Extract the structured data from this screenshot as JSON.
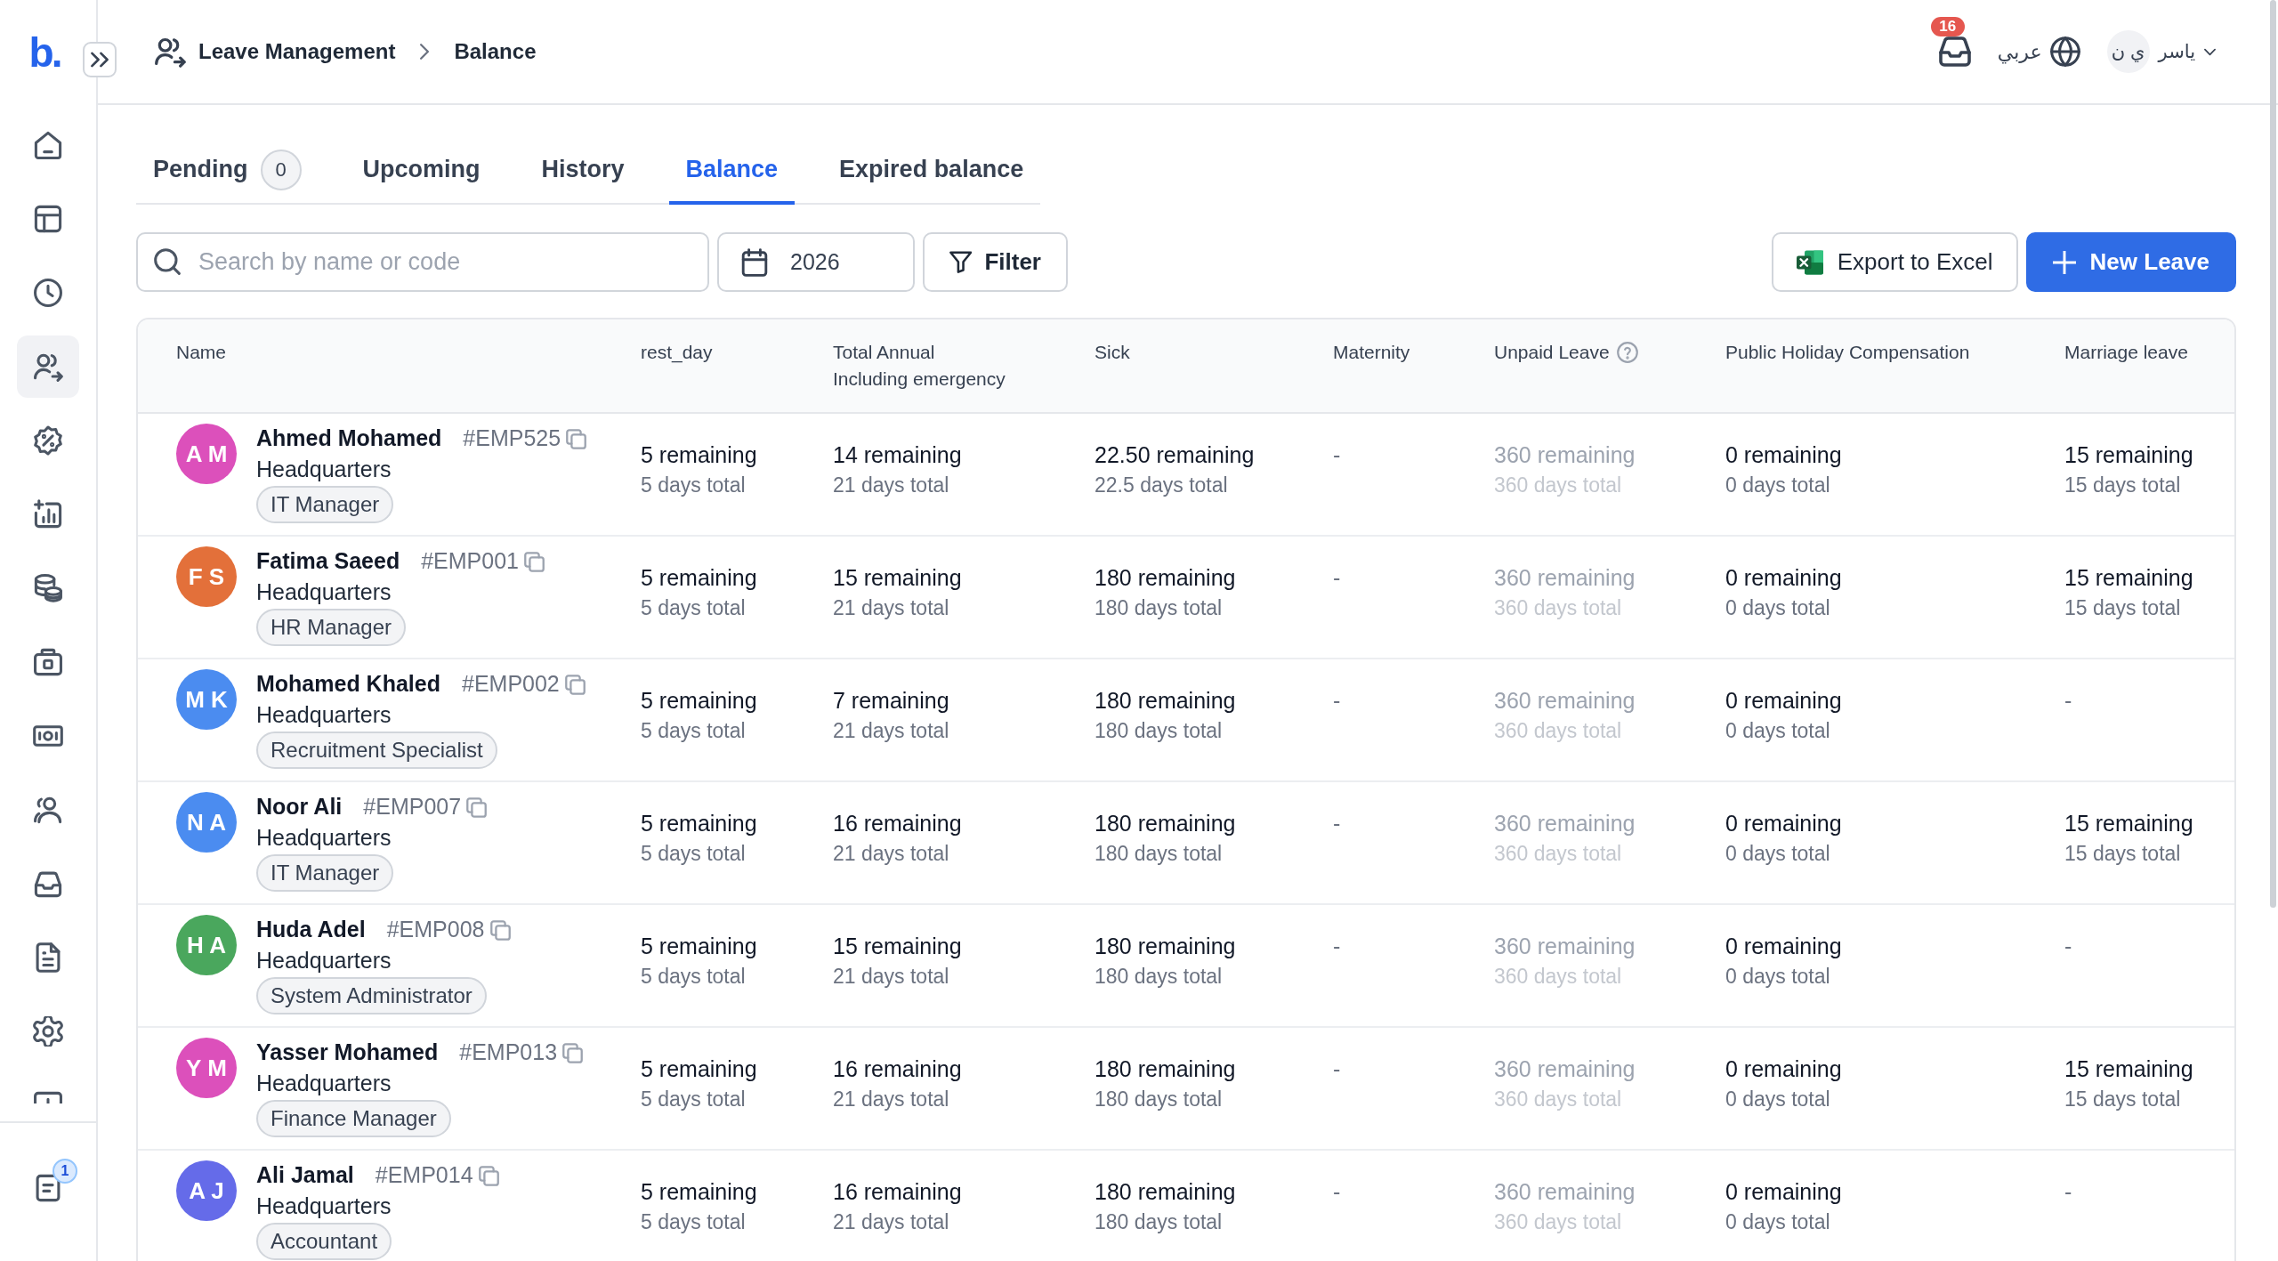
{
  "sidebar": {
    "logo": "b.",
    "items": [
      {
        "selected": false
      },
      {
        "selected": false
      },
      {
        "selected": false
      },
      {
        "selected": true
      },
      {
        "selected": false
      },
      {
        "selected": false
      },
      {
        "selected": false
      },
      {
        "selected": false
      },
      {
        "selected": false
      },
      {
        "selected": false
      },
      {
        "selected": false
      },
      {
        "selected": false
      },
      {
        "selected": false
      },
      {
        "selected": false
      }
    ],
    "footer_badge": "1"
  },
  "header": {
    "breadcrumb": [
      "Leave Management",
      "Balance"
    ],
    "notifications_count": "16",
    "language": "عربي",
    "user": {
      "initials": "ي ن",
      "name": "ياسر"
    }
  },
  "tabs": [
    {
      "label": "Pending",
      "count": "0",
      "selected": false
    },
    {
      "label": "Upcoming",
      "selected": false
    },
    {
      "label": "History",
      "selected": false
    },
    {
      "label": "Balance",
      "selected": true
    },
    {
      "label": "Expired balance",
      "selected": false
    }
  ],
  "toolbar": {
    "search": {
      "placeholder": "Search by name or code"
    },
    "year": "2026",
    "filter": "Filter",
    "export": "Export to Excel",
    "new_leave": "New Leave"
  },
  "table": {
    "columns": [
      {
        "label": "Name"
      },
      {
        "label": "rest_day"
      },
      {
        "label": "Total Annual",
        "sublabel": "Including emergency"
      },
      {
        "label": "Sick"
      },
      {
        "label": "Maternity"
      },
      {
        "label": "Unpaid Leave",
        "info_icon": true,
        "muted": true
      },
      {
        "label": "Public Holiday Compensation"
      },
      {
        "label": "Marriage leave"
      }
    ],
    "rows": [
      {
        "initials": "A M",
        "color": "#dc50bb",
        "name": "Ahmed Mohamed",
        "code": "#EMP525",
        "branch": "Headquarters",
        "role": "IT Manager",
        "balances": [
          {
            "kind": "balance",
            "remaining": "5 remaining",
            "total": "5 days total"
          },
          {
            "kind": "balance",
            "remaining": "14 remaining",
            "total": "21 days total"
          },
          {
            "kind": "balance",
            "remaining": "22.50 remaining",
            "total": "22.5 days total"
          },
          {
            "kind": "empty",
            "text": "-"
          },
          {
            "kind": "balance",
            "remaining": "360 remaining",
            "total": "360 days total"
          },
          {
            "kind": "balance",
            "remaining": "0 remaining",
            "total": "0 days total"
          },
          {
            "kind": "balance",
            "remaining": "15 remaining",
            "total": "15 days total"
          }
        ]
      },
      {
        "initials": "F S",
        "color": "#e3703a",
        "name": "Fatima Saeed",
        "code": "#EMP001",
        "branch": "Headquarters",
        "role": "HR Manager",
        "balances": [
          {
            "kind": "balance",
            "remaining": "5 remaining",
            "total": "5 days total"
          },
          {
            "kind": "balance",
            "remaining": "15 remaining",
            "total": "21 days total"
          },
          {
            "kind": "balance",
            "remaining": "180 remaining",
            "total": "180 days total"
          },
          {
            "kind": "empty",
            "text": "-"
          },
          {
            "kind": "balance",
            "remaining": "360 remaining",
            "total": "360 days total"
          },
          {
            "kind": "balance",
            "remaining": "0 remaining",
            "total": "0 days total"
          },
          {
            "kind": "balance",
            "remaining": "15 remaining",
            "total": "15 days total"
          }
        ]
      },
      {
        "initials": "M K",
        "color": "#4b8cf0",
        "name": "Mohamed Khaled",
        "code": "#EMP002",
        "branch": "Headquarters",
        "role": "Recruitment Specialist",
        "balances": [
          {
            "kind": "balance",
            "remaining": "5 remaining",
            "total": "5 days total"
          },
          {
            "kind": "balance",
            "remaining": "7 remaining",
            "total": "21 days total"
          },
          {
            "kind": "balance",
            "remaining": "180 remaining",
            "total": "180 days total"
          },
          {
            "kind": "empty",
            "text": "-"
          },
          {
            "kind": "balance",
            "remaining": "360 remaining",
            "total": "360 days total"
          },
          {
            "kind": "balance",
            "remaining": "0 remaining",
            "total": "0 days total"
          },
          {
            "kind": "empty",
            "text": "-"
          }
        ]
      },
      {
        "initials": "N A",
        "color": "#4b8cf0",
        "name": "Noor Ali",
        "code": "#EMP007",
        "branch": "Headquarters",
        "role": "IT Manager",
        "balances": [
          {
            "kind": "balance",
            "remaining": "5 remaining",
            "total": "5 days total"
          },
          {
            "kind": "balance",
            "remaining": "16 remaining",
            "total": "21 days total"
          },
          {
            "kind": "balance",
            "remaining": "180 remaining",
            "total": "180 days total"
          },
          {
            "kind": "empty",
            "text": "-"
          },
          {
            "kind": "balance",
            "remaining": "360 remaining",
            "total": "360 days total"
          },
          {
            "kind": "balance",
            "remaining": "0 remaining",
            "total": "0 days total"
          },
          {
            "kind": "balance",
            "remaining": "15 remaining",
            "total": "15 days total"
          }
        ]
      },
      {
        "initials": "H A",
        "color": "#4aa75d",
        "name": "Huda Adel",
        "code": "#EMP008",
        "branch": "Headquarters",
        "role": "System Administrator",
        "balances": [
          {
            "kind": "balance",
            "remaining": "5 remaining",
            "total": "5 days total"
          },
          {
            "kind": "balance",
            "remaining": "15 remaining",
            "total": "21 days total"
          },
          {
            "kind": "balance",
            "remaining": "180 remaining",
            "total": "180 days total"
          },
          {
            "kind": "empty",
            "text": "-"
          },
          {
            "kind": "balance",
            "remaining": "360 remaining",
            "total": "360 days total"
          },
          {
            "kind": "balance",
            "remaining": "0 remaining",
            "total": "0 days total"
          },
          {
            "kind": "empty",
            "text": "-"
          }
        ]
      },
      {
        "initials": "Y M",
        "color": "#dc50bb",
        "name": "Yasser Mohamed",
        "code": "#EMP013",
        "branch": "Headquarters",
        "role": "Finance Manager",
        "balances": [
          {
            "kind": "balance",
            "remaining": "5 remaining",
            "total": "5 days total"
          },
          {
            "kind": "balance",
            "remaining": "16 remaining",
            "total": "21 days total"
          },
          {
            "kind": "balance",
            "remaining": "180 remaining",
            "total": "180 days total"
          },
          {
            "kind": "empty",
            "text": "-"
          },
          {
            "kind": "balance",
            "remaining": "360 remaining",
            "total": "360 days total"
          },
          {
            "kind": "balance",
            "remaining": "0 remaining",
            "total": "0 days total"
          },
          {
            "kind": "balance",
            "remaining": "15 remaining",
            "total": "15 days total"
          }
        ]
      },
      {
        "initials": "A J",
        "color": "#656be9",
        "name": "Ali Jamal",
        "code": "#EMP014",
        "branch": "Headquarters",
        "role": "Accountant",
        "balances": [
          {
            "kind": "balance",
            "remaining": "5 remaining",
            "total": "5 days total"
          },
          {
            "kind": "balance",
            "remaining": "16 remaining",
            "total": "21 days total"
          },
          {
            "kind": "balance",
            "remaining": "180 remaining",
            "total": "180 days total"
          },
          {
            "kind": "empty",
            "text": "-"
          },
          {
            "kind": "balance",
            "remaining": "360 remaining",
            "total": "360 days total"
          },
          {
            "kind": "balance",
            "remaining": "0 remaining",
            "total": "0 days total"
          },
          {
            "kind": "empty",
            "text": "-"
          }
        ]
      }
    ]
  }
}
